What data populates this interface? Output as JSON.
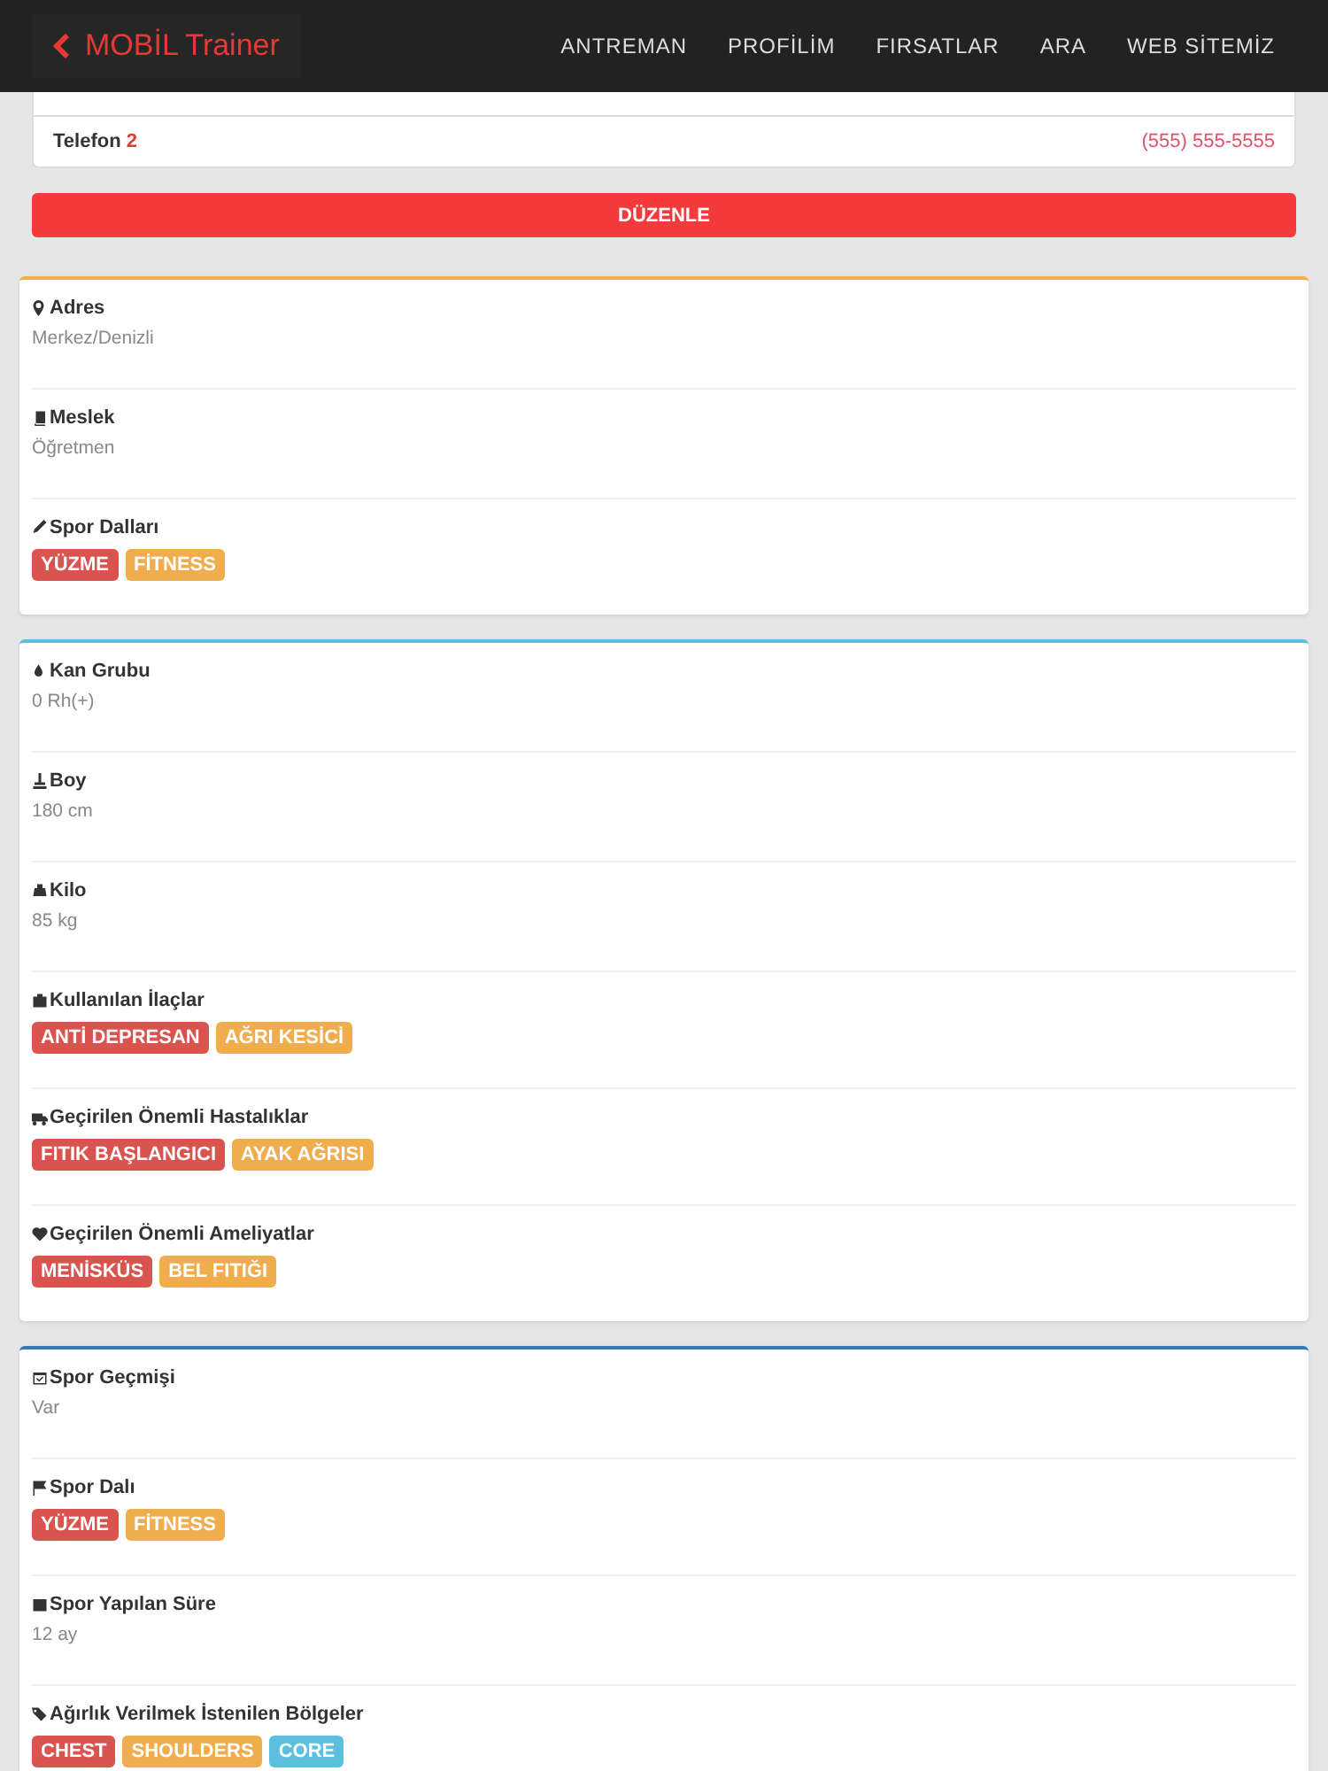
{
  "navbar": {
    "brand": "MOBİL Trainer",
    "links": [
      "ANTREMAN",
      "PROFİLİM",
      "FIRSATLAR",
      "ARA",
      "WEB SİTEMİZ"
    ]
  },
  "contacts": [
    {
      "label": "Telefon",
      "number": "2",
      "value": "(555) 555-5555"
    }
  ],
  "edit_button": "DÜZENLE",
  "sections": [
    {
      "color": "#f0ad4e",
      "fields": [
        {
          "kind": "text",
          "label": "Adres",
          "value": "Merkez/Denizli"
        },
        {
          "kind": "text",
          "label": "Meslek",
          "value": "Öğretmen"
        },
        {
          "kind": "tags",
          "label": "Spor Dalları",
          "tags": [
            {
              "text": "YÜZME",
              "color": "#d9534f"
            },
            {
              "text": "FİTNESS",
              "color": "#f0ad4e"
            }
          ]
        }
      ]
    },
    {
      "color": "#5bc0de",
      "fields": [
        {
          "kind": "text",
          "label": "Kan Grubu",
          "value": "0 Rh(+)"
        },
        {
          "kind": "text",
          "label": "Boy",
          "value": "180 cm"
        },
        {
          "kind": "text",
          "label": "Kilo",
          "value": "85 kg"
        },
        {
          "kind": "tags",
          "label": "Kullanılan İlaçlar",
          "tags": [
            {
              "text": "ANTİ DEPRESAN",
              "color": "#d9534f"
            },
            {
              "text": "AĞRI KESİCİ",
              "color": "#f0ad4e"
            }
          ]
        },
        {
          "kind": "tags",
          "label": "Geçirilen Önemli Hastalıklar",
          "tags": [
            {
              "text": "FITIK BAŞLANGICI",
              "color": "#d9534f"
            },
            {
              "text": "AYAK AĞRISI",
              "color": "#f0ad4e"
            }
          ]
        },
        {
          "kind": "tags",
          "label": "Geçirilen Önemli Ameliyatlar",
          "tags": [
            {
              "text": "MENİSKÜS",
              "color": "#d9534f"
            },
            {
              "text": "BEL FITIĞI",
              "color": "#f0ad4e"
            }
          ]
        }
      ]
    },
    {
      "color": "#337ab7",
      "fields": [
        {
          "kind": "text",
          "label": "Spor Geçmişi",
          "value": "Var"
        },
        {
          "kind": "tags",
          "label": "Spor Dalı",
          "tags": [
            {
              "text": "YÜZME",
              "color": "#d9534f"
            },
            {
              "text": "FİTNESS",
              "color": "#f0ad4e"
            }
          ]
        },
        {
          "kind": "text",
          "label": "Spor Yapılan Süre",
          "value": "12 ay"
        },
        {
          "kind": "tags",
          "label": "Ağırlık Verilmek İstenilen Bölgeler",
          "tags": [
            {
              "text": "CHEST",
              "color": "#d9534f"
            },
            {
              "text": "SHOULDERS",
              "color": "#f0ad4e"
            },
            {
              "text": "CORE",
              "color": "#5bc0de"
            }
          ]
        }
      ]
    }
  ]
}
